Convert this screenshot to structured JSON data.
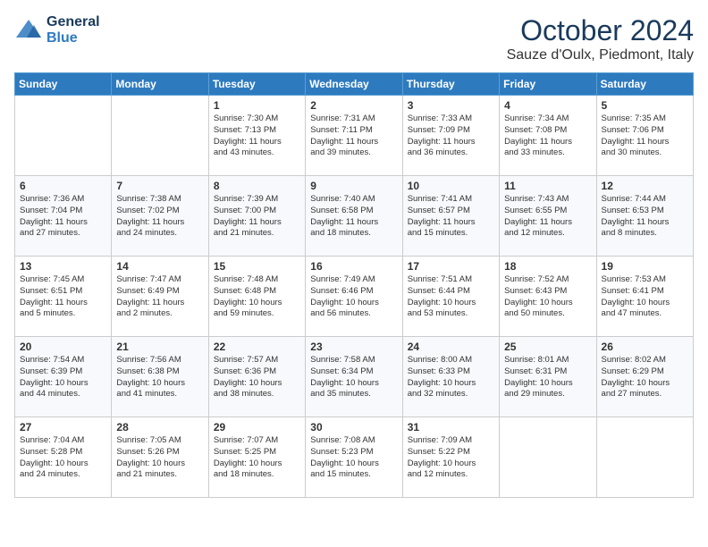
{
  "header": {
    "logo_line1": "General",
    "logo_line2": "Blue",
    "month": "October 2024",
    "location": "Sauze d'Oulx, Piedmont, Italy"
  },
  "columns": [
    "Sunday",
    "Monday",
    "Tuesday",
    "Wednesday",
    "Thursday",
    "Friday",
    "Saturday"
  ],
  "weeks": [
    [
      {
        "day": "",
        "info": ""
      },
      {
        "day": "",
        "info": ""
      },
      {
        "day": "1",
        "info": "Sunrise: 7:30 AM\nSunset: 7:13 PM\nDaylight: 11 hours\nand 43 minutes."
      },
      {
        "day": "2",
        "info": "Sunrise: 7:31 AM\nSunset: 7:11 PM\nDaylight: 11 hours\nand 39 minutes."
      },
      {
        "day": "3",
        "info": "Sunrise: 7:33 AM\nSunset: 7:09 PM\nDaylight: 11 hours\nand 36 minutes."
      },
      {
        "day": "4",
        "info": "Sunrise: 7:34 AM\nSunset: 7:08 PM\nDaylight: 11 hours\nand 33 minutes."
      },
      {
        "day": "5",
        "info": "Sunrise: 7:35 AM\nSunset: 7:06 PM\nDaylight: 11 hours\nand 30 minutes."
      }
    ],
    [
      {
        "day": "6",
        "info": "Sunrise: 7:36 AM\nSunset: 7:04 PM\nDaylight: 11 hours\nand 27 minutes."
      },
      {
        "day": "7",
        "info": "Sunrise: 7:38 AM\nSunset: 7:02 PM\nDaylight: 11 hours\nand 24 minutes."
      },
      {
        "day": "8",
        "info": "Sunrise: 7:39 AM\nSunset: 7:00 PM\nDaylight: 11 hours\nand 21 minutes."
      },
      {
        "day": "9",
        "info": "Sunrise: 7:40 AM\nSunset: 6:58 PM\nDaylight: 11 hours\nand 18 minutes."
      },
      {
        "day": "10",
        "info": "Sunrise: 7:41 AM\nSunset: 6:57 PM\nDaylight: 11 hours\nand 15 minutes."
      },
      {
        "day": "11",
        "info": "Sunrise: 7:43 AM\nSunset: 6:55 PM\nDaylight: 11 hours\nand 12 minutes."
      },
      {
        "day": "12",
        "info": "Sunrise: 7:44 AM\nSunset: 6:53 PM\nDaylight: 11 hours\nand 8 minutes."
      }
    ],
    [
      {
        "day": "13",
        "info": "Sunrise: 7:45 AM\nSunset: 6:51 PM\nDaylight: 11 hours\nand 5 minutes."
      },
      {
        "day": "14",
        "info": "Sunrise: 7:47 AM\nSunset: 6:49 PM\nDaylight: 11 hours\nand 2 minutes."
      },
      {
        "day": "15",
        "info": "Sunrise: 7:48 AM\nSunset: 6:48 PM\nDaylight: 10 hours\nand 59 minutes."
      },
      {
        "day": "16",
        "info": "Sunrise: 7:49 AM\nSunset: 6:46 PM\nDaylight: 10 hours\nand 56 minutes."
      },
      {
        "day": "17",
        "info": "Sunrise: 7:51 AM\nSunset: 6:44 PM\nDaylight: 10 hours\nand 53 minutes."
      },
      {
        "day": "18",
        "info": "Sunrise: 7:52 AM\nSunset: 6:43 PM\nDaylight: 10 hours\nand 50 minutes."
      },
      {
        "day": "19",
        "info": "Sunrise: 7:53 AM\nSunset: 6:41 PM\nDaylight: 10 hours\nand 47 minutes."
      }
    ],
    [
      {
        "day": "20",
        "info": "Sunrise: 7:54 AM\nSunset: 6:39 PM\nDaylight: 10 hours\nand 44 minutes."
      },
      {
        "day": "21",
        "info": "Sunrise: 7:56 AM\nSunset: 6:38 PM\nDaylight: 10 hours\nand 41 minutes."
      },
      {
        "day": "22",
        "info": "Sunrise: 7:57 AM\nSunset: 6:36 PM\nDaylight: 10 hours\nand 38 minutes."
      },
      {
        "day": "23",
        "info": "Sunrise: 7:58 AM\nSunset: 6:34 PM\nDaylight: 10 hours\nand 35 minutes."
      },
      {
        "day": "24",
        "info": "Sunrise: 8:00 AM\nSunset: 6:33 PM\nDaylight: 10 hours\nand 32 minutes."
      },
      {
        "day": "25",
        "info": "Sunrise: 8:01 AM\nSunset: 6:31 PM\nDaylight: 10 hours\nand 29 minutes."
      },
      {
        "day": "26",
        "info": "Sunrise: 8:02 AM\nSunset: 6:29 PM\nDaylight: 10 hours\nand 27 minutes."
      }
    ],
    [
      {
        "day": "27",
        "info": "Sunrise: 7:04 AM\nSunset: 5:28 PM\nDaylight: 10 hours\nand 24 minutes."
      },
      {
        "day": "28",
        "info": "Sunrise: 7:05 AM\nSunset: 5:26 PM\nDaylight: 10 hours\nand 21 minutes."
      },
      {
        "day": "29",
        "info": "Sunrise: 7:07 AM\nSunset: 5:25 PM\nDaylight: 10 hours\nand 18 minutes."
      },
      {
        "day": "30",
        "info": "Sunrise: 7:08 AM\nSunset: 5:23 PM\nDaylight: 10 hours\nand 15 minutes."
      },
      {
        "day": "31",
        "info": "Sunrise: 7:09 AM\nSunset: 5:22 PM\nDaylight: 10 hours\nand 12 minutes."
      },
      {
        "day": "",
        "info": ""
      },
      {
        "day": "",
        "info": ""
      }
    ]
  ]
}
